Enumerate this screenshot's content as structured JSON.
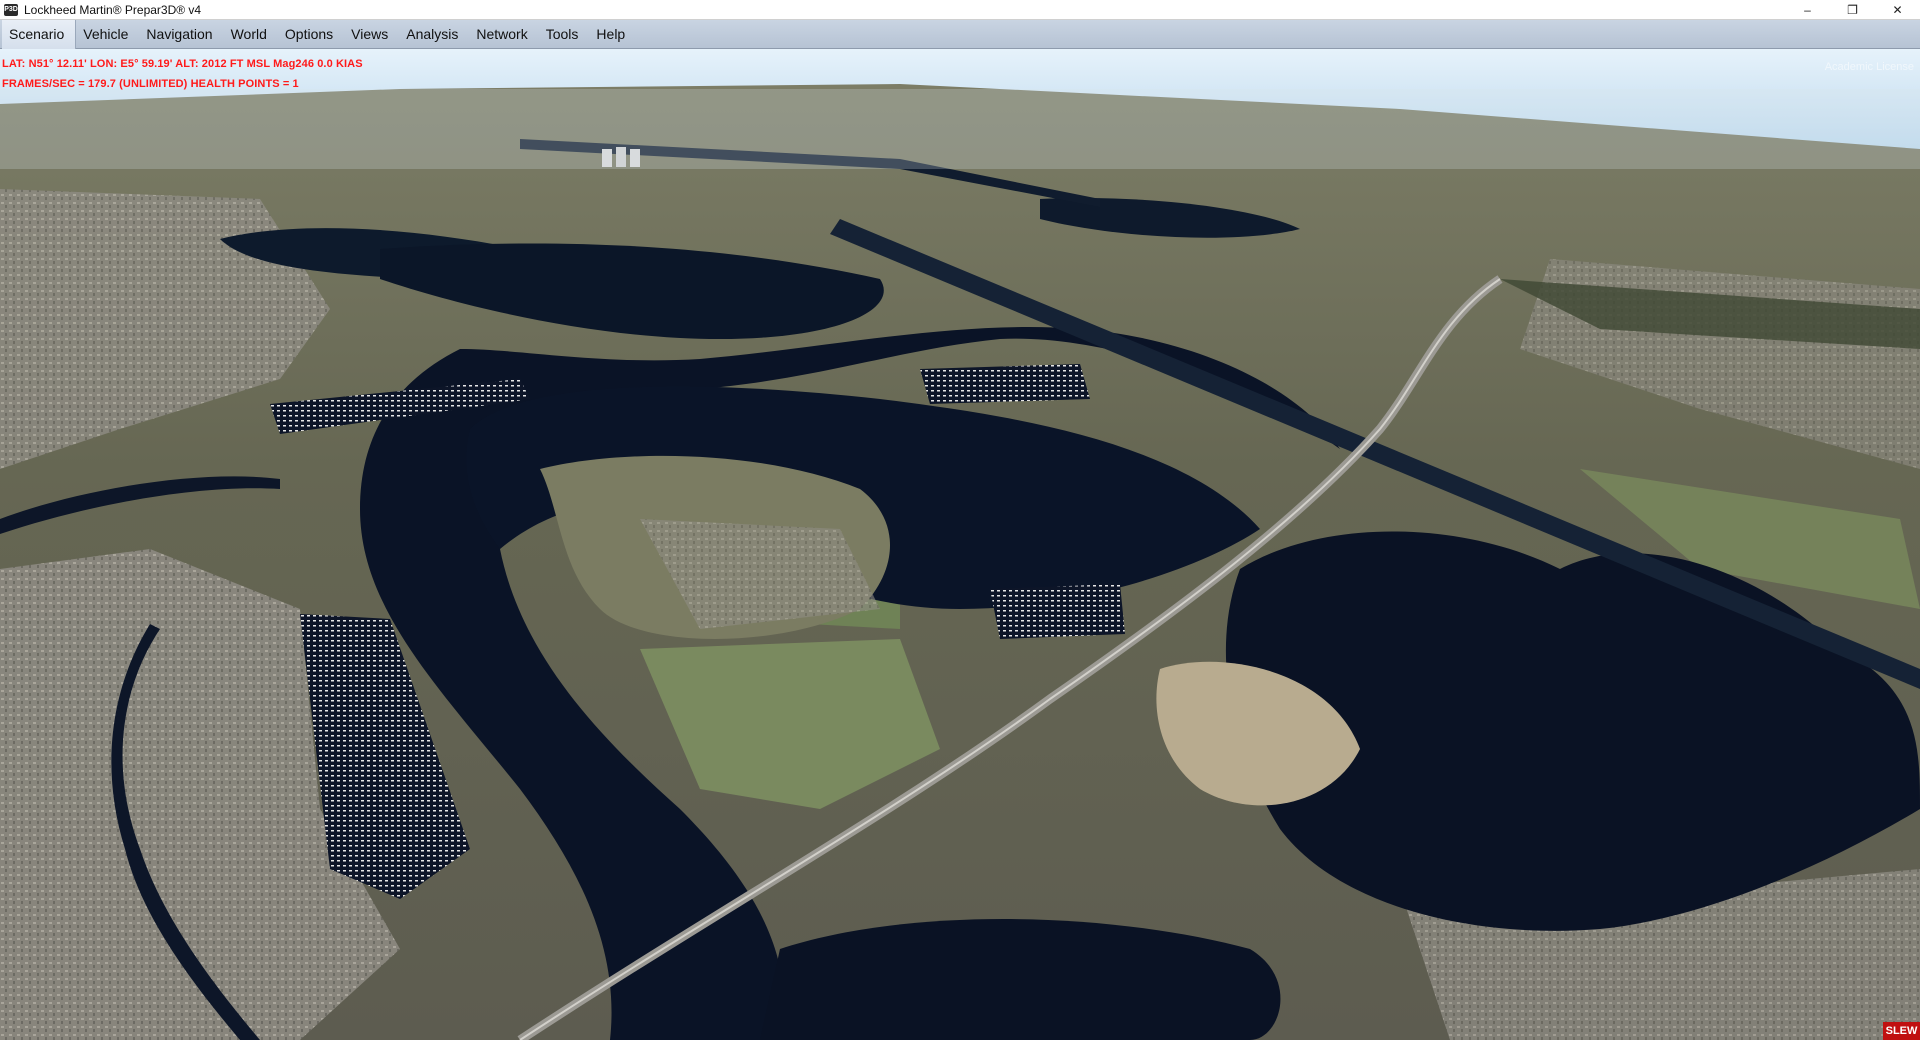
{
  "window": {
    "title": "Lockheed Martin® Prepar3D® v4",
    "icon": "prepar3d-app-icon",
    "controls": {
      "minimize": "–",
      "restore": "❐",
      "close": "✕"
    }
  },
  "menu": [
    {
      "label": "Scenario"
    },
    {
      "label": "Vehicle"
    },
    {
      "label": "Navigation"
    },
    {
      "label": "World"
    },
    {
      "label": "Options"
    },
    {
      "label": "Views"
    },
    {
      "label": "Analysis"
    },
    {
      "label": "Network"
    },
    {
      "label": "Tools"
    },
    {
      "label": "Help"
    }
  ],
  "hud": {
    "line1": "LAT: N51° 12.11'  LON: E5° 59.19'  ALT: 2012 FT  MSL   Mag246  0.0 KIAS",
    "line2": "FRAMES/SEC = 179.7   (UNLIMITED)   HEALTH POINTS = 1",
    "color": "#ff1a1a"
  },
  "license_watermark": "Academic License",
  "slew_indicator": "SLEW",
  "colors": {
    "water": "#0b1426",
    "sky": "#bcd9ee",
    "land": "#6b6a58",
    "urban": "#8c8a82",
    "field": "#7d8b66"
  }
}
